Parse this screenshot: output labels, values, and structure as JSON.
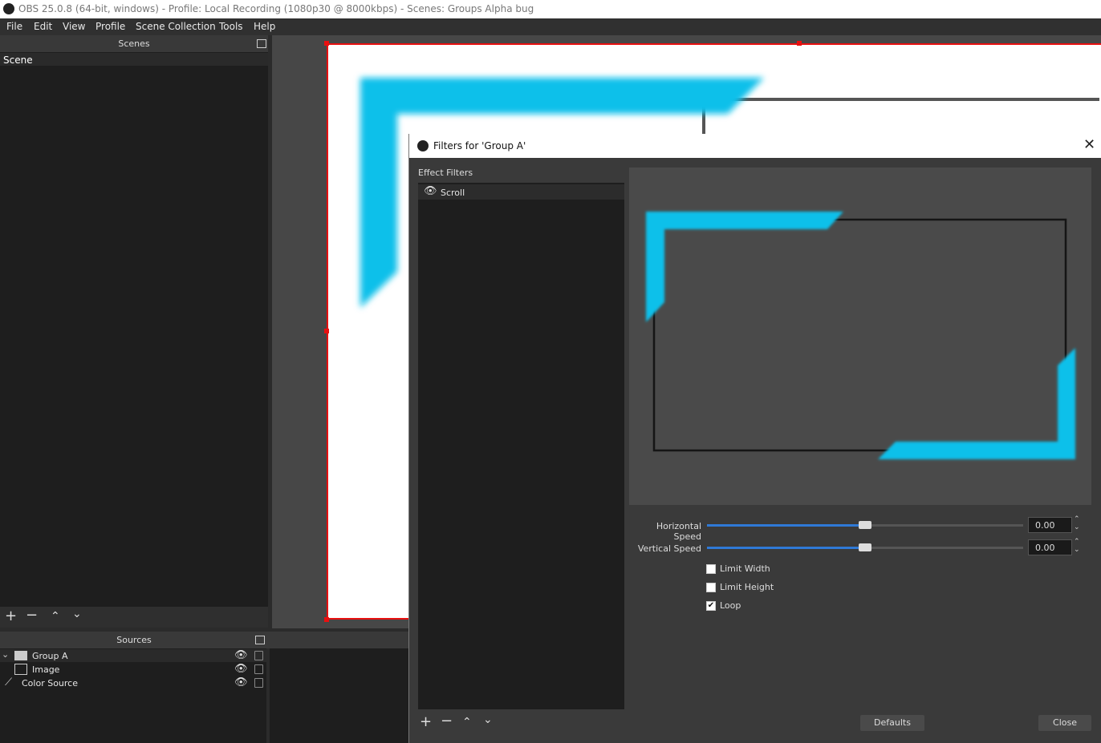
{
  "window": {
    "title": "OBS 25.0.8 (64-bit, windows) - Profile: Local Recording (1080p30 @ 8000kbps) - Scenes: Groups Alpha bug"
  },
  "menu": [
    "File",
    "Edit",
    "View",
    "Profile",
    "Scene Collection",
    "Tools",
    "Help"
  ],
  "scenes": {
    "header": "Scenes",
    "items": [
      "Scene"
    ]
  },
  "sources": {
    "header": "Sources",
    "items": [
      {
        "label": "Group A",
        "icon": "folder-icon"
      },
      {
        "label": "Image",
        "icon": "image-icon"
      },
      {
        "label": "Color Source",
        "icon": "brush-icon"
      }
    ]
  },
  "dialog": {
    "title": "Filters for 'Group A'",
    "effect_filters_label": "Effect Filters",
    "filters": [
      {
        "label": "Scroll"
      }
    ],
    "properties": {
      "horizontal_speed": {
        "label": "Horizontal Speed",
        "value": "0.00",
        "slider_fraction": 0.5
      },
      "vertical_speed": {
        "label": "Vertical Speed",
        "value": "0.00",
        "slider_fraction": 0.5
      },
      "limit_width": {
        "label": "Limit Width",
        "checked": false
      },
      "limit_height": {
        "label": "Limit Height",
        "checked": false
      },
      "loop": {
        "label": "Loop",
        "checked": true
      }
    },
    "defaults_label": "Defaults",
    "close_label": "Close"
  },
  "colors": {
    "accent": "#0ec0ea",
    "slider": "#2f79d6",
    "selection": "#e81010"
  }
}
